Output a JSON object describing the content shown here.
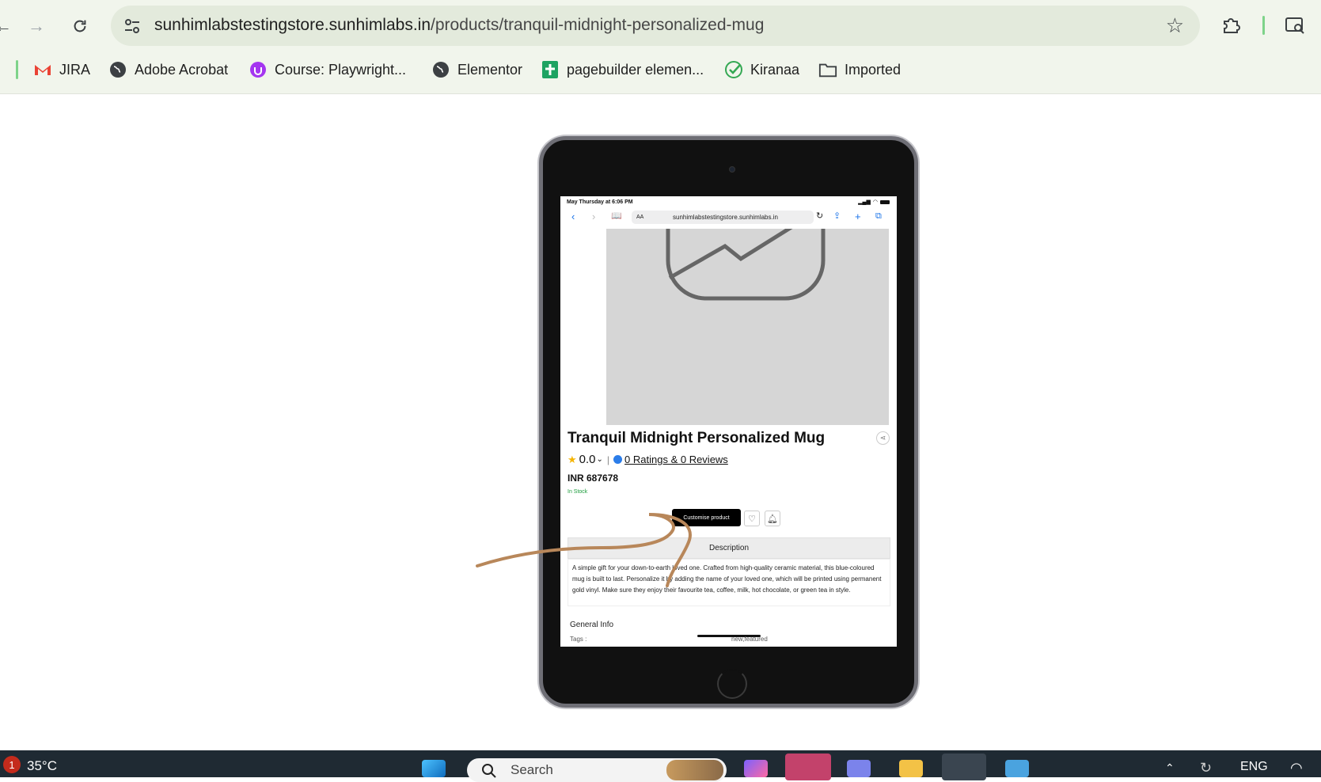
{
  "browser": {
    "url_host": "sunhimlabstestingstore.sunhimlabs.in",
    "url_path": "/products/tranquil-midnight-personalized-mug"
  },
  "bookmarks": [
    {
      "label": "JIRA",
      "icon": "gmail-icon"
    },
    {
      "label": "Adobe Acrobat",
      "icon": "globe-icon"
    },
    {
      "label": "Course: Playwright...",
      "icon": "udemy-icon"
    },
    {
      "label": "Elementor",
      "icon": "globe-icon"
    },
    {
      "label": "pagebuilder elemen...",
      "icon": "sheets-icon"
    },
    {
      "label": "Kiranaa",
      "icon": "check-circle-icon"
    },
    {
      "label": "Imported",
      "icon": "folder-icon"
    }
  ],
  "device": {
    "status_time": "May Thursday at 6:06 PM",
    "safari_text_size": "AA",
    "safari_host": "sunhimlabstestingstore.sunhimlabs.in"
  },
  "product": {
    "title": "Tranquil Midnight Personalized Mug",
    "rating": "0.0",
    "ratings_link": "0 Ratings  & 0 Reviews",
    "price": "INR 687678",
    "stock": "In Stock",
    "customise_label": "Customise product",
    "description_tab": "Description",
    "description": "A simple gift for your down-to-earth loved one. Crafted from high-quality ceramic material, this blue-coloured mug is built to last. Personalize it by adding the name of your loved one, which will be printed using permanent gold vinyl. Make sure they enjoy their favourite tea, coffee, milk, hot chocolate, or green tea in style.",
    "general_info": "General Info",
    "tags_label": "Tags :",
    "tags_value": "new,featured"
  },
  "taskbar": {
    "notification_count": "1",
    "temperature": "35°C",
    "search_placeholder": "Search",
    "language": "ENG"
  },
  "colors": {
    "chrome_bg": "#f1f5ec",
    "omnibox_bg": "#e3eadc",
    "stock_green": "#1c9c3c",
    "annotation_stroke": "#b8875a"
  }
}
